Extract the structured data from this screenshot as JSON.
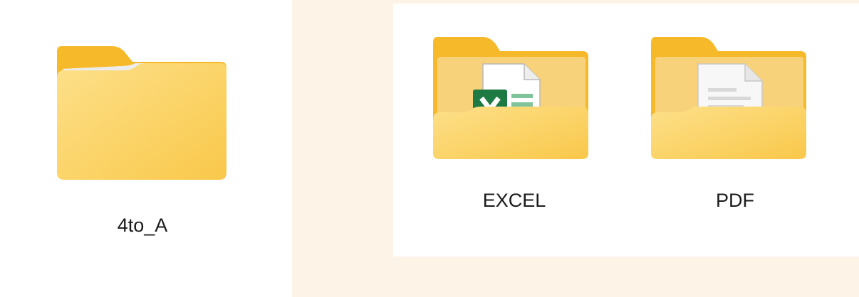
{
  "folders": [
    {
      "name": "4to_A",
      "icon": "folder-icon",
      "contents": "empty"
    },
    {
      "name": "EXCEL",
      "icon": "excel-folder-icon",
      "contents": "excel-file"
    },
    {
      "name": "PDF",
      "icon": "document-folder-icon",
      "contents": "document-file"
    }
  ],
  "colors": {
    "background": "#fdf3e6",
    "panel": "#ffffff",
    "folder_back": "#f6bc2e",
    "folder_front": "#fddb7a",
    "excel_green": "#1d7a43"
  }
}
